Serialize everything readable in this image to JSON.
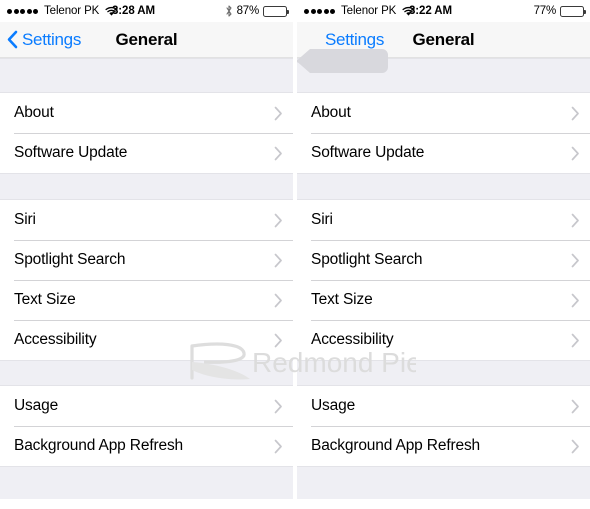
{
  "colors": {
    "accent_blue": "#0a7cff",
    "group_bg": "#efeff4",
    "row_bg": "#ffffff",
    "separator": "#d3d3d6",
    "navbar_bg": "#f7f7f7",
    "chevron_gray": "#c7c7cc",
    "text_black": "#000000",
    "watermark_gray": "#dcdcdc",
    "back_highlight": "#d8d8dd"
  },
  "panels": [
    {
      "id": "left",
      "status_bar": {
        "signal_dots_filled": 5,
        "signal_dots_total": 5,
        "carrier": "Telenor PK",
        "wifi_icon": "wifi-icon",
        "time": "3:28 AM",
        "bluetooth_icon": "bluetooth-icon",
        "bluetooth_visible": true,
        "battery_percent": "87%",
        "battery_level": 87,
        "battery_icon": "battery-icon"
      },
      "nav_bar": {
        "back_icon": "chevron-left-icon",
        "back_label": "Settings",
        "back_pressed": false,
        "title": "General"
      },
      "sections": [
        {
          "rows": [
            {
              "label": "About",
              "accessory": "chevron-right-icon"
            },
            {
              "label": "Software Update",
              "accessory": "chevron-right-icon"
            }
          ]
        },
        {
          "rows": [
            {
              "label": "Siri",
              "accessory": "chevron-right-icon"
            },
            {
              "label": "Spotlight Search",
              "accessory": "chevron-right-icon"
            },
            {
              "label": "Text Size",
              "accessory": "chevron-right-icon"
            },
            {
              "label": "Accessibility",
              "accessory": "chevron-right-icon"
            }
          ]
        },
        {
          "rows": [
            {
              "label": "Usage",
              "accessory": "chevron-right-icon"
            },
            {
              "label": "Background App Refresh",
              "accessory": "chevron-right-icon"
            }
          ]
        }
      ]
    },
    {
      "id": "right",
      "status_bar": {
        "signal_dots_filled": 5,
        "signal_dots_total": 5,
        "carrier": "Telenor PK",
        "wifi_icon": "wifi-icon",
        "time": "3:22 AM",
        "bluetooth_icon": "bluetooth-icon",
        "bluetooth_visible": false,
        "battery_percent": "77%",
        "battery_level": 77,
        "battery_icon": "battery-icon"
      },
      "nav_bar": {
        "back_icon": "chevron-left-icon",
        "back_label": "Settings",
        "back_pressed": true,
        "title": "General"
      },
      "sections": [
        {
          "rows": [
            {
              "label": "About",
              "accessory": "chevron-right-icon"
            },
            {
              "label": "Software Update",
              "accessory": "chevron-right-icon"
            }
          ]
        },
        {
          "rows": [
            {
              "label": "Siri",
              "accessory": "chevron-right-icon"
            },
            {
              "label": "Spotlight Search",
              "accessory": "chevron-right-icon"
            },
            {
              "label": "Text Size",
              "accessory": "chevron-right-icon"
            },
            {
              "label": "Accessibility",
              "accessory": "chevron-right-icon"
            }
          ]
        },
        {
          "rows": [
            {
              "label": "Usage",
              "accessory": "chevron-right-icon"
            },
            {
              "label": "Background App Refresh",
              "accessory": "chevron-right-icon"
            }
          ]
        }
      ]
    }
  ],
  "watermark": {
    "text": "Redmond Pie",
    "logo_icon": "redmond-pie-logo-icon"
  }
}
